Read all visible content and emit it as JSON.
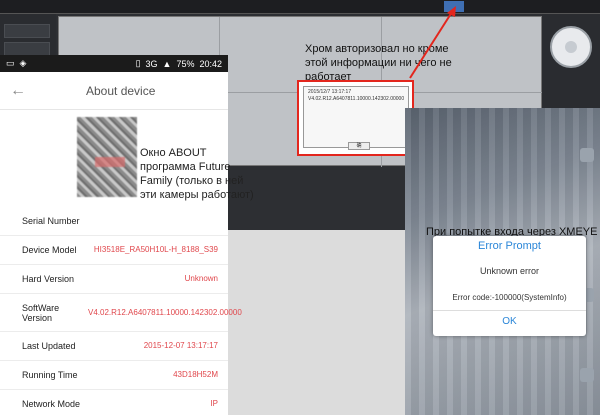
{
  "desktop": {
    "top_buttons": [
      "",
      ""
    ],
    "ptz_labels": [
      "",
      "",
      ""
    ]
  },
  "phone": {
    "status": {
      "network": "3G",
      "battery": "75%",
      "time": "20:42"
    },
    "title": "About device",
    "overlay_note": "Окно ABOUT программа Future Family (только в ней эти камеры работают)",
    "rows": [
      {
        "label": "Serial Number",
        "value": ""
      },
      {
        "label": "Device Model",
        "value": "HI3518E_RA50H10L-H_8188_S39"
      },
      {
        "label": "Hard Version",
        "value": "Unknown"
      },
      {
        "label": "SoftWare Version",
        "value": "V4.02.R12.A6407811.10000.142302.00000"
      },
      {
        "label": "Last Updated",
        "value": "2015-12-07 13:17:17"
      },
      {
        "label": "Running Time",
        "value": "43D18H52M"
      },
      {
        "label": "Network Mode",
        "value": "IP"
      }
    ]
  },
  "chrome_note": "Хром авторизовал но кроме этой информации ни чего не работает",
  "info_dialog": {
    "lines": [
      "",
      "",
      "",
      "2015/12/7 13:17:17",
      "",
      "V4.02.R12.A6407811.10000.142302.00000",
      ""
    ],
    "ok": "确"
  },
  "xmeye_note": "При попытке входа через XMEYE",
  "error_dialog": {
    "title": "Error Prompt",
    "message": "Unknown error",
    "code": "Error code:-100000(SystemInfo)",
    "ok": "OK"
  },
  "colors": {
    "accent_red": "#e0474c",
    "annotation_red": "#e3261d",
    "prompt_blue": "#2a86d8"
  }
}
